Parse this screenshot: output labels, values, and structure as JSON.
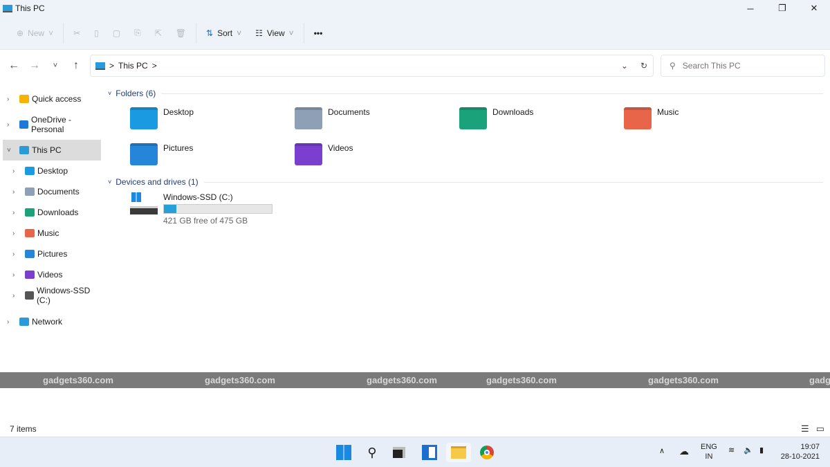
{
  "window": {
    "title": "This PC",
    "controls": [
      "─",
      "❐",
      "✕"
    ]
  },
  "toolbar": {
    "new": "New",
    "sort": "Sort",
    "view": "View",
    "more": "•••"
  },
  "address": {
    "crumb": "This PC",
    "sep": ">"
  },
  "search": {
    "placeholder": "Search This PC"
  },
  "sidebar": {
    "items": [
      {
        "label": "Quick access",
        "color": "#f5b400"
      },
      {
        "label": "OneDrive - Personal",
        "color": "#1e7ad6"
      },
      {
        "label": "This PC",
        "color": "#2a9bd8"
      },
      {
        "label": "Desktop",
        "color": "#1a9ae0"
      },
      {
        "label": "Documents",
        "color": "#8ea0b5"
      },
      {
        "label": "Downloads",
        "color": "#1aa37a"
      },
      {
        "label": "Music",
        "color": "#e8654a"
      },
      {
        "label": "Pictures",
        "color": "#2585d8"
      },
      {
        "label": "Videos",
        "color": "#7b3fd0"
      },
      {
        "label": "Windows-SSD (C:)",
        "color": "#555555"
      },
      {
        "label": "Network",
        "color": "#2a9bd8"
      }
    ]
  },
  "main": {
    "folders_header": "Folders (6)",
    "folders": [
      {
        "label": "Desktop",
        "color": "#1a9ae0"
      },
      {
        "label": "Documents",
        "color": "#8ea0b5"
      },
      {
        "label": "Downloads",
        "color": "#1aa37a"
      },
      {
        "label": "Music",
        "color": "#e8654a"
      },
      {
        "label": "Pictures",
        "color": "#2585d8"
      },
      {
        "label": "Videos",
        "color": "#7b3fd0"
      }
    ],
    "drives_header": "Devices and drives (1)",
    "drive": {
      "label": "Windows-SSD (C:)",
      "free": "421 GB free of 475 GB",
      "used_fraction": 0.114
    }
  },
  "watermark": {
    "text": "gadgets360.com",
    "partial": "gadg"
  },
  "status": {
    "items": "7 items"
  },
  "taskbar": {
    "lang1": "ENG",
    "lang2": "IN",
    "time": "19:07",
    "date": "28-10-2021"
  }
}
